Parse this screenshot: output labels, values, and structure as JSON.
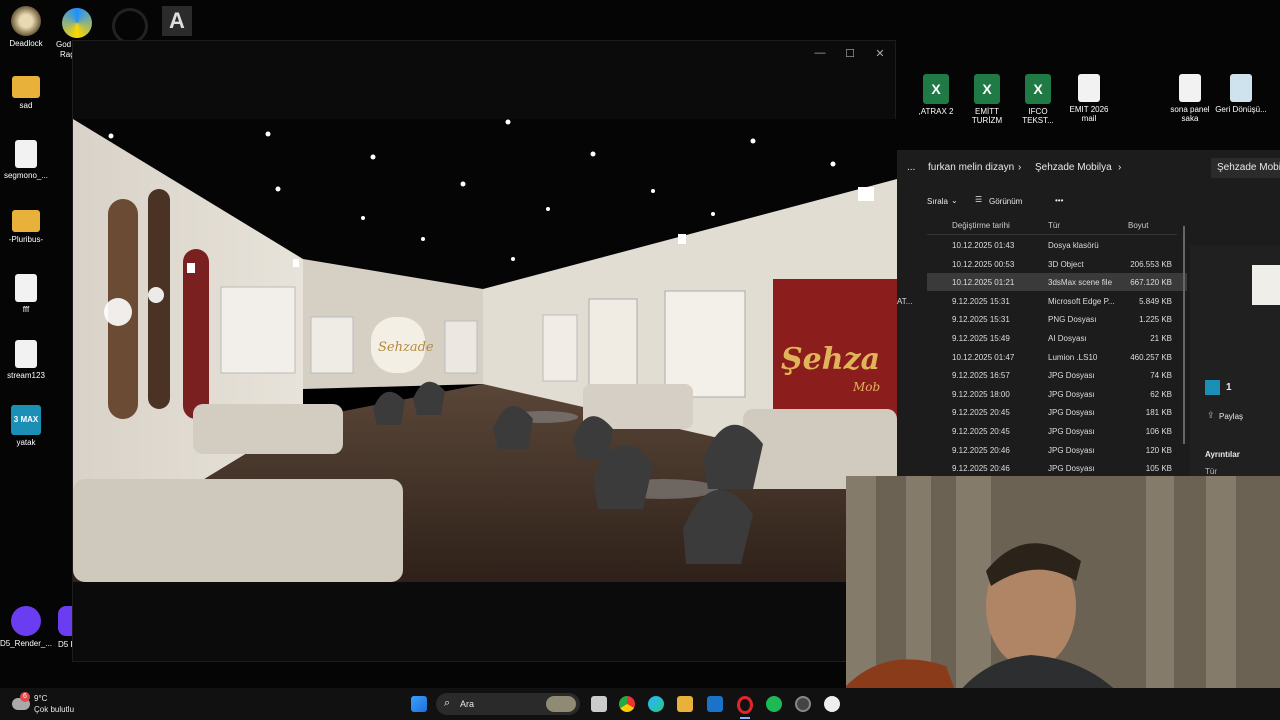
{
  "desktop": {
    "icons_left": [
      {
        "label": "Deadlock"
      },
      {
        "label": "sad"
      },
      {
        "label": "segmono_..."
      },
      {
        "label": "-Pluribus-"
      },
      {
        "label": "fff"
      },
      {
        "label": "stream123"
      },
      {
        "label": "yatak"
      },
      {
        "label": "D5_Render_..."
      }
    ],
    "icons_top": [
      {
        "label": "God"
      },
      {
        "label": "Rag"
      }
    ],
    "icons_right": [
      {
        "label": ",ATRAX 2"
      },
      {
        "label": "EMİTT TURİZM"
      },
      {
        "label": "IFCO TEKST..."
      },
      {
        "label": "EMIT 2026 mail"
      },
      {
        "label": "sona panel saka"
      },
      {
        "label": "Geri Dönüşü..."
      }
    ],
    "max_badge": "3 MAX",
    "d5_badge": "D5 F"
  },
  "viewer": {
    "controls": {
      "minimize": "—",
      "maximize": "☐",
      "close": "✕"
    },
    "scene": {
      "left_sign": "Sehzade",
      "right_sign": "Şehza",
      "right_sign_sub": "Mob"
    }
  },
  "explorer": {
    "breadcrumb": [
      "...",
      "furkan melin dizayn",
      "Şehzade Mobilya"
    ],
    "search_placeholder": "Şehzade Mobily",
    "toolbar": {
      "sort": "Sırala",
      "view": "Görünüm",
      "more": "•••"
    },
    "columns": [
      "Değiştirme tarihi",
      "Tür",
      "Boyut"
    ],
    "rows": [
      {
        "prefix": "",
        "date": "10.12.2025 01:43",
        "type": "Dosya klasörü",
        "size": ""
      },
      {
        "prefix": "",
        "date": "10.12.2025 00:53",
        "type": "3D Object",
        "size": "206.553 KB"
      },
      {
        "prefix": "",
        "date": "10.12.2025 01:21",
        "type": "3dsMax scene file",
        "size": "667.120 KB"
      },
      {
        "prefix": "AT...",
        "date": "9.12.2025 15:31",
        "type": "Microsoft Edge P...",
        "size": "5.849 KB"
      },
      {
        "prefix": "",
        "date": "9.12.2025 15:31",
        "type": "PNG Dosyası",
        "size": "1.225 KB"
      },
      {
        "prefix": "",
        "date": "9.12.2025 15:49",
        "type": "AI Dosyası",
        "size": "21 KB"
      },
      {
        "prefix": "",
        "date": "10.12.2025 01:47",
        "type": "Lumion .LS10",
        "size": "460.257 KB"
      },
      {
        "prefix": "",
        "date": "9.12.2025 16:57",
        "type": "JPG Dosyası",
        "size": "74 KB"
      },
      {
        "prefix": "",
        "date": "9.12.2025 18:00",
        "type": "JPG Dosyası",
        "size": "62 KB"
      },
      {
        "prefix": "",
        "date": "9.12.2025 20:45",
        "type": "JPG Dosyası",
        "size": "181 KB"
      },
      {
        "prefix": "",
        "date": "9.12.2025 20:45",
        "type": "JPG Dosyası",
        "size": "106 KB"
      },
      {
        "prefix": "",
        "date": "9.12.2025 20:46",
        "type": "JPG Dosyası",
        "size": "120 KB"
      },
      {
        "prefix": "",
        "date": "9.12.2025 20:46",
        "type": "JPG Dosyası",
        "size": "105 KB"
      }
    ],
    "details": {
      "count": "1",
      "share": "Paylaş",
      "section": "Ayrıntılar",
      "type_label": "Tür"
    }
  },
  "taskbar": {
    "weather_temp": "9°C",
    "weather_desc": "Çok bulutlu",
    "weather_badge": "6",
    "search_label": "Ara",
    "apps": [
      "windows-icon",
      "search",
      "widgets-icon",
      "task-view-icon",
      "chrome-icon",
      "edge-icon",
      "file-explorer-icon",
      "mail-icon",
      "opera-icon",
      "spotify-icon",
      "settings-icon",
      "media-icon"
    ]
  }
}
